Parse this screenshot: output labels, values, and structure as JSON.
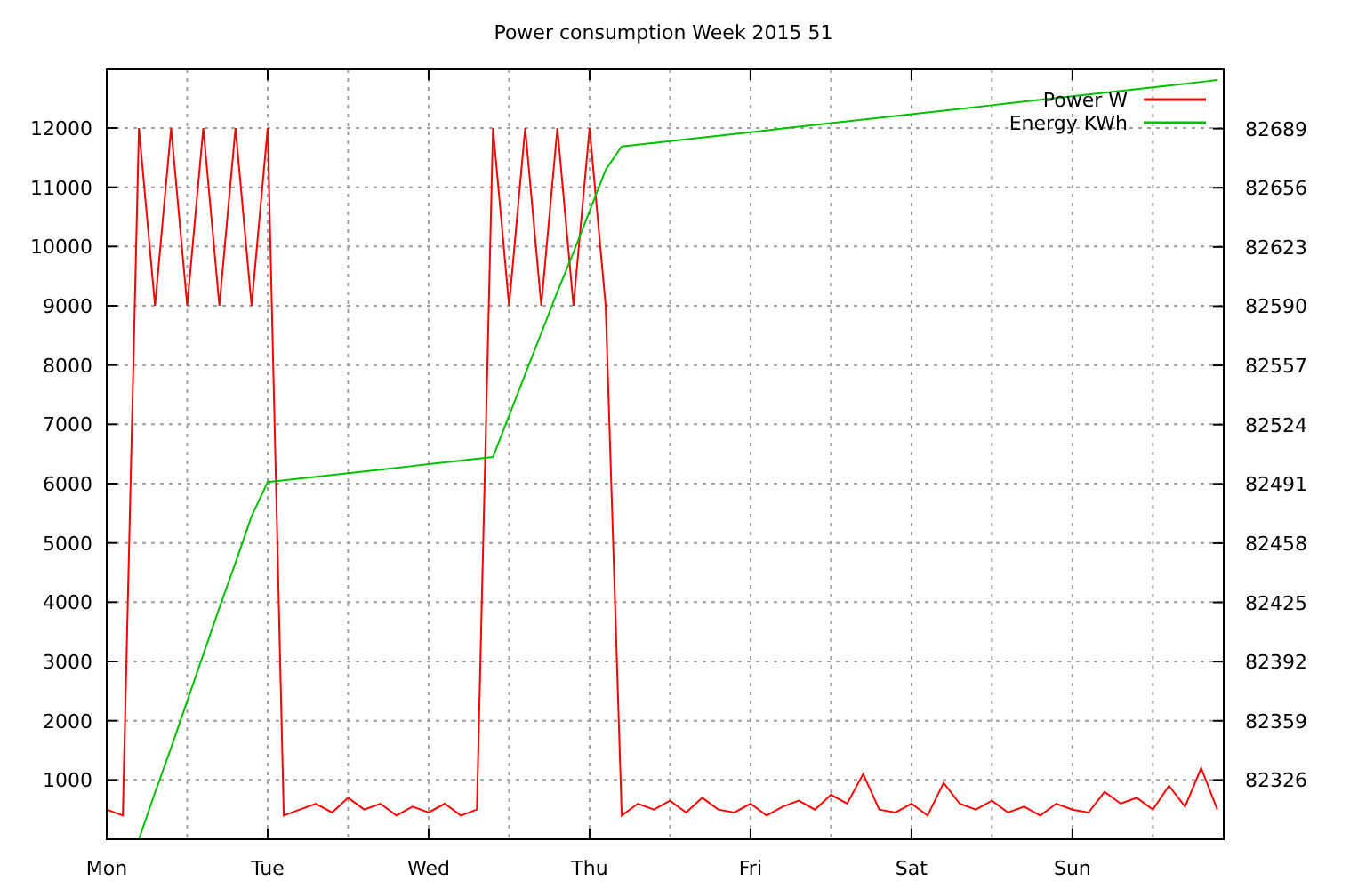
{
  "chart_data": {
    "type": "line",
    "title": "Power consumption Week 2015 51",
    "categories": [
      "Mon",
      null,
      null,
      null,
      null,
      null,
      null,
      null,
      null,
      null,
      "Tue",
      null,
      null,
      null,
      null,
      null,
      null,
      null,
      null,
      null,
      "Wed",
      null,
      null,
      null,
      null,
      null,
      null,
      null,
      null,
      null,
      "Thu",
      null,
      null,
      null,
      null,
      null,
      null,
      null,
      null,
      null,
      "Fri",
      null,
      null,
      null,
      null,
      null,
      null,
      null,
      null,
      null,
      "Sat",
      null,
      null,
      null,
      null,
      null,
      null,
      null,
      null,
      null,
      "Sun",
      null,
      null,
      null,
      null,
      null,
      null,
      null,
      null,
      null
    ],
    "series": [
      {
        "name": "Power W",
        "color": "#ff0000",
        "values": [
          500,
          400,
          12000,
          9000,
          12000,
          9000,
          12000,
          9000,
          12000,
          9000,
          12000,
          400,
          500,
          600,
          450,
          700,
          500,
          600,
          400,
          550,
          450,
          600,
          400,
          500,
          12000,
          9000,
          12000,
          9000,
          12000,
          9000,
          12000,
          9000,
          400,
          600,
          500,
          650,
          450,
          700,
          500,
          450,
          600,
          400,
          550,
          650,
          500,
          750,
          600,
          1100,
          500,
          450,
          600,
          400,
          950,
          600,
          500,
          650,
          450,
          550,
          400,
          600,
          500,
          450,
          800,
          600,
          700,
          500,
          900,
          550,
          1200,
          500
        ]
      },
      {
        "name": "Energy KWh",
        "color": "#00c000",
        "axis": "y2",
        "values": [
          null,
          null,
          82293,
          82319,
          82344,
          82370,
          82396,
          82422,
          82447,
          82473,
          82492,
          82493,
          82494,
          82495,
          82496,
          82497,
          82498,
          82499,
          82500,
          82501,
          82502,
          82503,
          82504,
          82505,
          82506,
          82529,
          82552,
          82575,
          82598,
          82620,
          82643,
          82666,
          82679,
          82680,
          82681,
          82682,
          82683,
          82684,
          82685,
          82686,
          82687,
          82688,
          82689,
          82690,
          82691,
          82692,
          82693,
          82694,
          82695,
          82696,
          82697,
          82698,
          82699,
          82700,
          82701,
          82702,
          82703,
          82704,
          82705,
          82706,
          82707,
          82708,
          82709,
          82710,
          82711,
          82712,
          82713,
          82714,
          82715,
          82716
        ]
      }
    ],
    "grid": true,
    "legend": true,
    "ylim": [
      0,
      12990
    ],
    "y2lim": [
      82293,
      82722
    ],
    "yticks": [
      {
        "value": 1000,
        "label": "1000"
      },
      {
        "value": 2000,
        "label": "2000"
      },
      {
        "value": 3000,
        "label": "3000"
      },
      {
        "value": 4000,
        "label": "4000"
      },
      {
        "value": 5000,
        "label": "5000"
      },
      {
        "value": 6000,
        "label": "6000"
      },
      {
        "value": 7000,
        "label": "7000"
      },
      {
        "value": 8000,
        "label": "8000"
      },
      {
        "value": 9000,
        "label": "9000"
      },
      {
        "value": 10000,
        "label": "10000"
      },
      {
        "value": 11000,
        "label": "11000"
      },
      {
        "value": 12000,
        "label": "12000"
      }
    ],
    "y2ticks": [
      {
        "value": 82326,
        "label": "82326"
      },
      {
        "value": 82359,
        "label": "82359"
      },
      {
        "value": 82392,
        "label": "82392"
      },
      {
        "value": 82425,
        "label": "82425"
      },
      {
        "value": 82458,
        "label": "82458"
      },
      {
        "value": 82491,
        "label": "82491"
      },
      {
        "value": 82524,
        "label": "82524"
      },
      {
        "value": 82557,
        "label": "82557"
      },
      {
        "value": 82590,
        "label": "82590"
      },
      {
        "value": 82623,
        "label": "82623"
      },
      {
        "value": 82656,
        "label": "82656"
      },
      {
        "value": 82689,
        "label": "82689"
      }
    ]
  }
}
